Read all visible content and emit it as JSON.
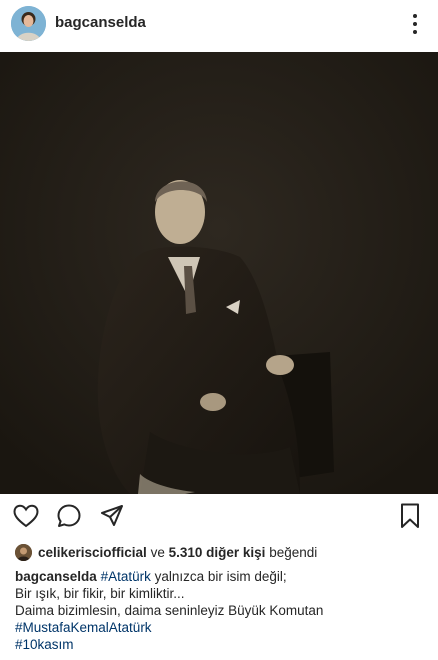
{
  "post": {
    "username": "bagcanselda",
    "image_alt_icon": "portrait-photo"
  },
  "actions": {
    "like_icon": "heart-icon",
    "comment_icon": "comment-icon",
    "share_icon": "share-icon",
    "save_icon": "bookmark-icon"
  },
  "likes": {
    "first_user": "celikerisciofficial",
    "connector": "ve",
    "others": "5.310 diğer kişi",
    "suffix": "beğendi"
  },
  "caption": {
    "username": "bagcanselda",
    "hashtag_1": "#Atatürk",
    "line1_rest": "yalnızca bir isim değil;",
    "line2": "Bir ışık, bir fikir, bir kimliktir...",
    "line3": "Daima bizimlesin, daima seninleyiz Büyük Komutan",
    "hashtag_2": "#MustafaKemalAtatürk",
    "hashtag_3": "#10kasım"
  },
  "colors": {
    "text": "#262626",
    "hashtag": "#003569",
    "photo_background": "#211c15"
  }
}
